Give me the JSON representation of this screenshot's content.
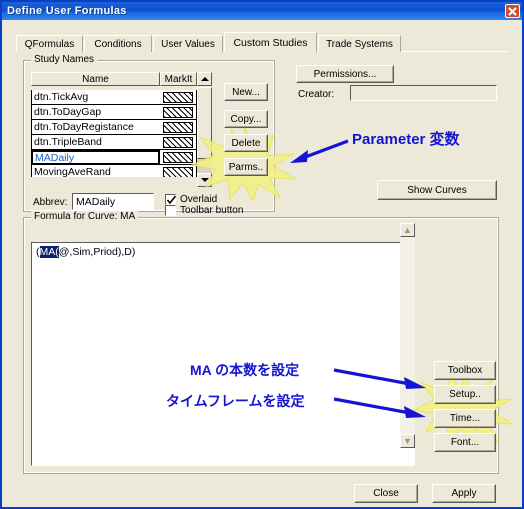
{
  "window": {
    "title": "Define User Formulas",
    "close_icon": "close-icon"
  },
  "tabs": [
    {
      "label": "QFormulas",
      "active": false
    },
    {
      "label": "Conditions",
      "active": false
    },
    {
      "label": "User Values",
      "active": false
    },
    {
      "label": "Custom Studies",
      "active": true
    },
    {
      "label": "Trade Systems",
      "active": false
    }
  ],
  "study_names": {
    "group_label": "Study Names",
    "columns": [
      "Name",
      "MarkIt"
    ],
    "rows": [
      {
        "name": "dtn.TickAvg",
        "markit": "hatch",
        "editing": false
      },
      {
        "name": "dtn.ToDayGap",
        "markit": "hatch",
        "editing": false
      },
      {
        "name": "dtn.ToDayRegistance",
        "markit": "hatch",
        "editing": false
      },
      {
        "name": "dtn.TripleBand",
        "markit": "hatch",
        "editing": false
      },
      {
        "name": "MADaily",
        "markit": "hatch",
        "editing": true
      },
      {
        "name": "MovingAveRand",
        "markit": "hatch",
        "editing": false
      }
    ],
    "abbrev_label": "Abbrev:",
    "abbrev_value": "MADaily",
    "checkboxes": [
      {
        "label": "Overlaid",
        "checked": true
      },
      {
        "label": "Toolbar button",
        "checked": false
      }
    ],
    "buttons": [
      {
        "label": "New...",
        "highlighted": false
      },
      {
        "label": "Copy...",
        "highlighted": false
      },
      {
        "label": "Delete",
        "highlighted": false
      },
      {
        "label": "Parms..",
        "highlighted": true
      }
    ]
  },
  "right_panel": {
    "permissions_label": "Permissions...",
    "creator_label": "Creator:",
    "creator_value": "",
    "show_curves_label": "Show Curves"
  },
  "formula": {
    "group_label": "Formula for Curve: MA",
    "text_before": "(",
    "text_selected": "MA(",
    "text_after": "@,Sim,Priod),D)",
    "full_text": "(MA(@,Sim,Priod),D)"
  },
  "tool_buttons": [
    {
      "label": "Toolbox",
      "highlighted": false
    },
    {
      "label": "Setup..",
      "highlighted": true
    },
    {
      "label": "Time...",
      "highlighted": true
    },
    {
      "label": "Font...",
      "highlighted": false
    }
  ],
  "dialog_buttons": [
    {
      "label": "Close"
    },
    {
      "label": "Apply"
    }
  ],
  "annotations": [
    {
      "text": "Parameter 変数",
      "color": "#1414d2"
    },
    {
      "text": "MA の本数を設定",
      "color": "#1414d2"
    },
    {
      "text": "タイムフレームを設定",
      "color": "#1414d2"
    }
  ],
  "colors": {
    "dialog_bg": "#ece9d8",
    "title_blue": "#0a4fd0",
    "annotation_blue": "#1414d2",
    "burst_yellow": "#f2ef7a",
    "selection_blue": "#0a246a",
    "edit_text_blue": "#1b5fd0"
  }
}
